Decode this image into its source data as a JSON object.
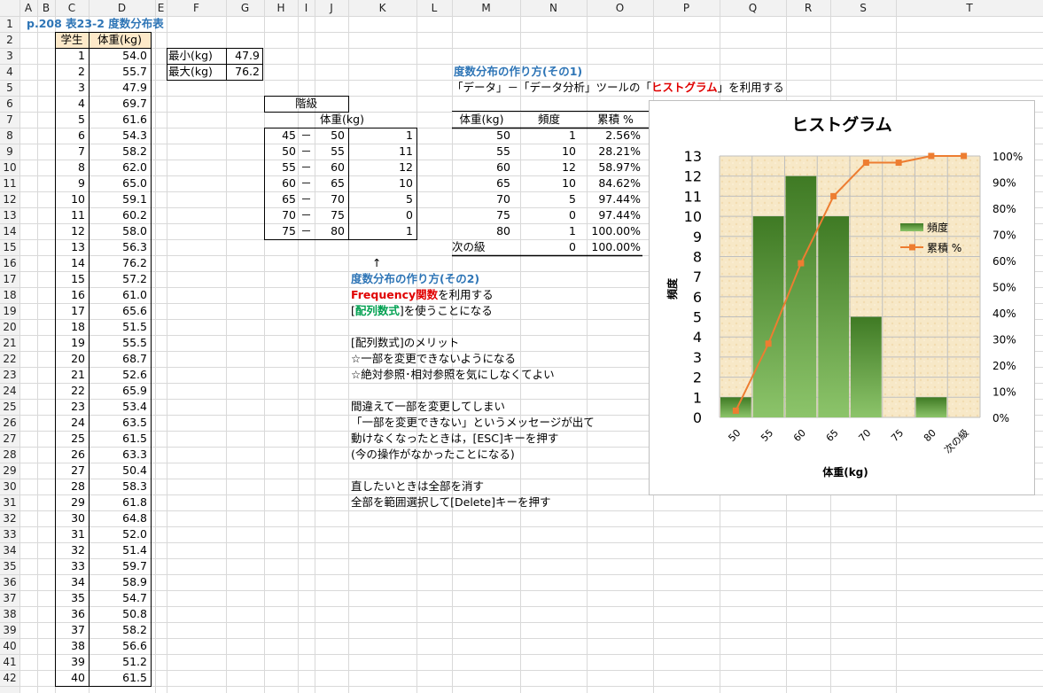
{
  "columns": [
    "A",
    "B",
    "C",
    "D",
    "E",
    "F",
    "G",
    "H",
    "I",
    "J",
    "K",
    "L",
    "M",
    "N",
    "O",
    "P",
    "Q",
    "R",
    "S",
    "T"
  ],
  "title": "p.208  表23-2  度数分布表",
  "header": {
    "student": "学生",
    "weight": "体重(kg)"
  },
  "students": [
    [
      "1",
      "54.0"
    ],
    [
      "2",
      "55.7"
    ],
    [
      "3",
      "47.9"
    ],
    [
      "4",
      "69.7"
    ],
    [
      "5",
      "61.6"
    ],
    [
      "6",
      "54.3"
    ],
    [
      "7",
      "58.2"
    ],
    [
      "8",
      "62.0"
    ],
    [
      "9",
      "65.0"
    ],
    [
      "10",
      "59.1"
    ],
    [
      "11",
      "60.2"
    ],
    [
      "12",
      "58.0"
    ],
    [
      "13",
      "56.3"
    ],
    [
      "14",
      "76.2"
    ],
    [
      "15",
      "57.2"
    ],
    [
      "16",
      "61.0"
    ],
    [
      "17",
      "65.6"
    ],
    [
      "18",
      "51.5"
    ],
    [
      "19",
      "55.5"
    ],
    [
      "20",
      "68.7"
    ],
    [
      "21",
      "52.6"
    ],
    [
      "22",
      "65.9"
    ],
    [
      "23",
      "53.4"
    ],
    [
      "24",
      "63.5"
    ],
    [
      "25",
      "61.5"
    ],
    [
      "26",
      "63.3"
    ],
    [
      "27",
      "50.4"
    ],
    [
      "28",
      "58.3"
    ],
    [
      "29",
      "61.8"
    ],
    [
      "30",
      "64.8"
    ],
    [
      "31",
      "52.0"
    ],
    [
      "32",
      "51.4"
    ],
    [
      "33",
      "59.7"
    ],
    [
      "34",
      "58.9"
    ],
    [
      "35",
      "54.7"
    ],
    [
      "36",
      "50.8"
    ],
    [
      "37",
      "58.2"
    ],
    [
      "38",
      "56.6"
    ],
    [
      "39",
      "51.2"
    ],
    [
      "40",
      "61.5"
    ]
  ],
  "minmax": [
    [
      "最小(kg)",
      "47.9"
    ],
    [
      "最大(kg)",
      "76.2"
    ]
  ],
  "class_table": {
    "title": "階級",
    "subtitle": "体重(kg)",
    "rows": [
      [
        "45",
        "－",
        "50",
        "1"
      ],
      [
        "50",
        "－",
        "55",
        "11"
      ],
      [
        "55",
        "－",
        "60",
        "12"
      ],
      [
        "60",
        "－",
        "65",
        "10"
      ],
      [
        "65",
        "－",
        "70",
        "5"
      ],
      [
        "70",
        "－",
        "75",
        "0"
      ],
      [
        "75",
        "－",
        "80",
        "1"
      ]
    ]
  },
  "method1": {
    "title": "度数分布の作り方(その1)",
    "desc_pre": "「データ」－「データ分析」ツールの「",
    "desc_red": "ヒストグラム",
    "desc_post": "」を利用する"
  },
  "hist_table": {
    "headers": [
      "体重(kg)",
      "頻度",
      "累積 %"
    ],
    "rows": [
      [
        "50",
        "1",
        "2.56%"
      ],
      [
        "55",
        "10",
        "28.21%"
      ],
      [
        "60",
        "12",
        "58.97%"
      ],
      [
        "65",
        "10",
        "84.62%"
      ],
      [
        "70",
        "5",
        "97.44%"
      ],
      [
        "75",
        "0",
        "97.44%"
      ],
      [
        "80",
        "1",
        "100.00%"
      ],
      [
        "次の級",
        "0",
        "100.00%"
      ]
    ]
  },
  "arrow": "↑",
  "method2": {
    "title": "度数分布の作り方(その2)",
    "line1_red": "Frequency関数",
    "line1_post": "を利用する",
    "line2_pre": "[",
    "line2_green": "配列数式",
    "line2_post": "]を使うことになる",
    "notes": [
      "[配列数式]のメリット",
      "☆一部を変更できないようになる",
      "☆絶対参照･相対参照を気にしなくてよい",
      "",
      "間違えて一部を変更してしまい",
      "「一部を変更できない」というメッセージが出て",
      "動けなくなったときは，[ESC]キーを押す",
      "(今の操作がなかったことになる)",
      "",
      "直したいときは全部を消す",
      "全部を範囲選択して[Delete]キーを押す"
    ]
  },
  "colors": {
    "bar": "#5a9a3a",
    "line": "#ed7d31",
    "title_blue": "#2e75b6",
    "red": "#e00000",
    "green": "#00a050"
  },
  "chart_data": {
    "type": "bar",
    "title": "ヒストグラム",
    "categories": [
      "50",
      "55",
      "60",
      "65",
      "70",
      "75",
      "80",
      "次の級"
    ],
    "series": [
      {
        "name": "頻度",
        "values": [
          1,
          10,
          12,
          10,
          5,
          0,
          1,
          0
        ]
      },
      {
        "name": "累積 %",
        "values": [
          2.56,
          28.21,
          58.97,
          84.62,
          97.44,
          97.44,
          100,
          100
        ]
      }
    ],
    "xlabel": "体重(kg)",
    "ylabel": "頻度",
    "ylim": [
      0,
      13
    ],
    "y2lim": [
      0,
      100
    ],
    "yticks": [
      "0",
      "1",
      "2",
      "3",
      "4",
      "5",
      "6",
      "7",
      "8",
      "9",
      "10",
      "11",
      "12",
      "13"
    ],
    "y2ticks": [
      "0%",
      "10%",
      "20%",
      "30%",
      "40%",
      "50%",
      "60%",
      "70%",
      "80%",
      "90%",
      "100%"
    ],
    "legend": "right"
  }
}
